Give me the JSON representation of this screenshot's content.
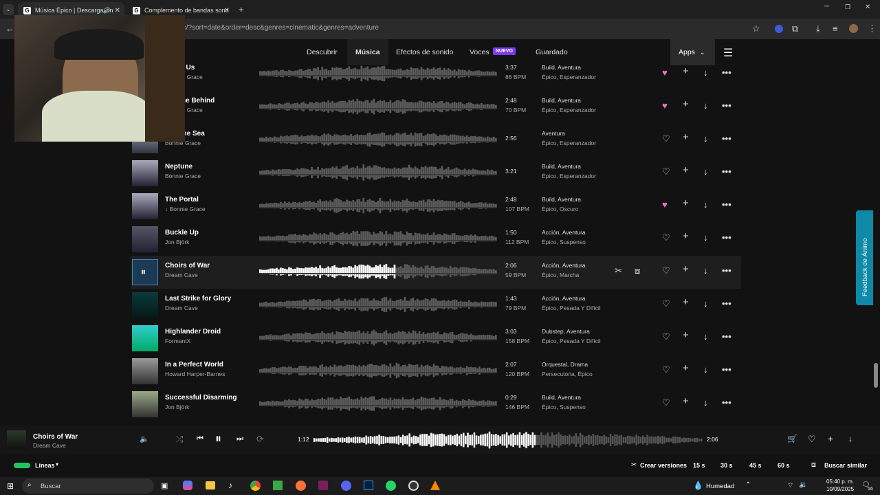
{
  "browser": {
    "tabs": [
      {
        "title": "Música Épico | Descarga sin"
      },
      {
        "title": "Complemento de bandas sono"
      }
    ],
    "url": "pic/?sort=date&order=desc&genres=cinematic&genres=adventure"
  },
  "nav": {
    "links": [
      "Descubrir",
      "Música",
      "Efectos de sonido",
      "Voces",
      "Guardado"
    ],
    "new_badge": "NUEVO",
    "apps": "Apps"
  },
  "tracks": [
    {
      "title": "…s of Us",
      "artist": "…onnie Grace",
      "duration": "3:37",
      "bpm": "86 BPM",
      "genres1": [
        "Build",
        "Aventura"
      ],
      "genres2": [
        "Épico",
        "Esperanzador"
      ],
      "favorite": true
    },
    {
      "title": "No One Behind",
      "artist": "…onnie Grace",
      "duration": "2:48",
      "bpm": "70 BPM",
      "genres1": [
        "Build",
        "Aventura"
      ],
      "genres2": [
        "Épico",
        "Esperanzador"
      ],
      "favorite": true
    },
    {
      "title": "…of the Sea",
      "artist": "Bonnie Grace",
      "duration": "2:56",
      "bpm": "",
      "genres1": [
        "Aventura"
      ],
      "genres2": [
        "Épico",
        "Esperanzador"
      ],
      "favorite": false
    },
    {
      "title": "Neptune",
      "artist": "Bonnie Grace",
      "duration": "3:21",
      "bpm": "",
      "genres1": [
        "Build",
        "Aventura"
      ],
      "genres2": [
        "Épico",
        "Esperanzador"
      ],
      "favorite": false
    },
    {
      "title": "The Portal",
      "artist": "Bonnie Grace",
      "duration": "2:48",
      "bpm": "107 BPM",
      "genres1": [
        "Build",
        "Aventura"
      ],
      "genres2": [
        "Épico",
        "Oscuro"
      ],
      "favorite": true,
      "downloaded": true
    },
    {
      "title": "Buckle Up",
      "artist": "Jon Björk",
      "duration": "1:50",
      "bpm": "112 BPM",
      "genres1": [
        "Acción",
        "Aventura"
      ],
      "genres2": [
        "Épico",
        "Suspenso"
      ],
      "favorite": false
    },
    {
      "title": "Choirs of War",
      "artist": "Dream Cave",
      "duration": "2:06",
      "bpm": "59 BPM",
      "genres1": [
        "Acción",
        "Aventura"
      ],
      "genres2": [
        "Épico",
        "Marcha"
      ],
      "favorite": false,
      "playing": true,
      "progress": 0.57
    },
    {
      "title": "Last Strike for Glory",
      "artist": "Dream Cave",
      "duration": "1:43",
      "bpm": "79 BPM",
      "genres1": [
        "Acción",
        "Aventura"
      ],
      "genres2": [
        "Épico",
        "Pesada Y Difícil"
      ],
      "favorite": false
    },
    {
      "title": "Highlander Droid",
      "artist": "FormantX",
      "duration": "3:03",
      "bpm": "158 BPM",
      "genres1": [
        "Dubstep",
        "Aventura"
      ],
      "genres2": [
        "Épico",
        "Pesada Y Difícil"
      ],
      "favorite": false
    },
    {
      "title": "In a Perfect World",
      "artist": "Howard Harper-Barnes",
      "duration": "2:07",
      "bpm": "120 BPM",
      "genres1": [
        "Orquestal",
        "Drama"
      ],
      "genres2": [
        "Persecutoria",
        "Épico"
      ],
      "favorite": false
    },
    {
      "title": "Successful Disarming",
      "artist": "Jon Björk",
      "duration": "0:29",
      "bpm": "146 BPM",
      "genres1": [
        "Build",
        "Aventura"
      ],
      "genres2": [
        "Épico",
        "Suspenso"
      ],
      "favorite": false
    }
  ],
  "player": {
    "title": "Choirs of War",
    "artist": "Dream Cave",
    "current": "1:12",
    "total": "2:06",
    "progress": 0.57
  },
  "player_bar2": {
    "lineas": "Líneas",
    "crear_versiones": "Crear versiones",
    "durations": [
      "15 s",
      "30 s",
      "45 s",
      "60 s"
    ],
    "buscar_similar": "Buscar similar"
  },
  "feedback": "Feedback de Ánimo",
  "taskbar": {
    "search": "Buscar",
    "weather": "Humedad",
    "time": "05:40 p. m.",
    "date": "10/09/2025",
    "badge": "16"
  },
  "colors": {
    "favorite": "#ff6ec7",
    "accent": "#7c3aed",
    "feedback": "#0e89a8"
  }
}
